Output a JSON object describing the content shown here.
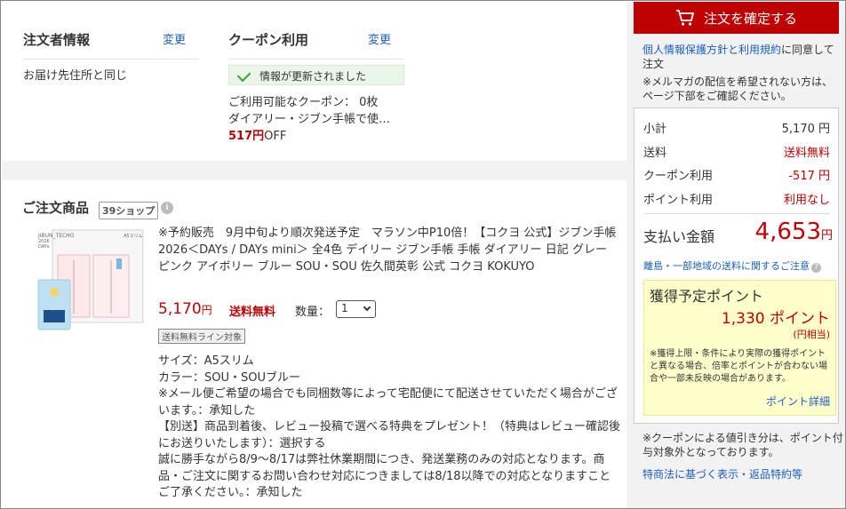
{
  "orderer": {
    "title": "注文者情報",
    "change": "変更",
    "address": "お届け先住所と同じ"
  },
  "coupon": {
    "title": "クーポン利用",
    "change": "変更",
    "notice": "情報が更新されました",
    "available": "ご利用可能なクーポン： 0枚",
    "name": "ダイアリー・ジブン手帳で使…",
    "discount_value": "517円",
    "discount_suffix": "OFF"
  },
  "products": {
    "title": "ご注文商品",
    "shop_badge": "39ショップ",
    "info_icon": "i",
    "thumb_brand": "JIBUN_TECHO",
    "thumb_year": "2026",
    "thumb_edition": "DAYs",
    "thumb_size": "A5スリム",
    "description": "※予約販売　9月中旬より順次発送予定　マラソン中P10倍！【コクヨ 公式】ジブン手帳2026＜DAYs / DAYs mini＞ 全4色 デイリー ジブン手帳 手帳 ダイアリー 日記 グレー ピンク アイボリー ブルー SOU・SOU 佐久間英彰 公式 コクヨ KOKUYO",
    "price": "5,170",
    "price_unit": "円",
    "free_shipping": "送料無料",
    "qty_label": "数量：",
    "qty_value": "1",
    "ship_tag": "送料無料ライン対象",
    "details": [
      "サイズ：A5スリム",
      "カラー：SOU・SOUブルー",
      "※メール便ご希望の場合でも同梱数等によって宅配便にて配送させていただく場合がございます。：承知した",
      "【別送】商品到着後、レビュー投稿で選べる特典をプレゼント！（特典はレビュー確認後にお送りいたします）：選択する",
      "誠に勝手ながら8/9〜8/17は弊社休業期間につき、発送業務のみの対応となります。商品・ご注文に関するお問い合わせ対応につきましては8/18以降での対応となりますことご了承ください。：承知した"
    ]
  },
  "sidebar": {
    "confirm_button": "注文を確定する",
    "agree_link": "個人情報保護方針と利用規約",
    "agree_text": "に同意して注文",
    "mail_note": "※メルマガの配信を希望されない方は、ページ下部をご確認ください。",
    "summary": {
      "subtotal_label": "小計",
      "subtotal_value": "5,170 円",
      "shipping_label": "送料",
      "shipping_value": "送料無料",
      "coupon_label": "クーポン利用",
      "coupon_value": "-517 円",
      "point_label": "ポイント利用",
      "point_value": "利用なし",
      "total_label": "支払い金額",
      "total_value": "4,653",
      "total_unit": "円",
      "remote_link": "離島・一部地域の送料に関するご注意",
      "remote_icon": "?"
    },
    "points": {
      "title": "獲得予定ポイント",
      "value": "1,330 ポイント",
      "sub": "(円相当)",
      "note": "※獲得上限・条件により実際の獲得ポイントと異なる場合、倍率とポイントが合わない場合や一部未反映の場合があります。",
      "detail_link": "ポイント詳細"
    },
    "coupon_note": "※クーポンによる値引き分は、ポイント付与対象外となっております。",
    "law_link": "特商法に基づく表示・返品特約等"
  },
  "colors": {
    "accent": "#bf0000",
    "link": "#1d5fbf",
    "notice_bg": "#e9f6e9",
    "points_bg": "#ffffcc"
  }
}
